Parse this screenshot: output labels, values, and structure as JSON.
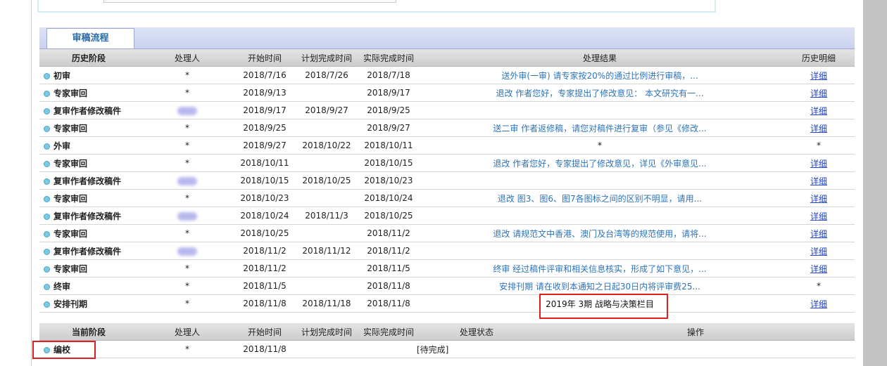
{
  "section": {
    "tab_label": "审稿流程"
  },
  "history": {
    "headers": [
      "历史阶段",
      "处理人",
      "开始时间",
      "计划完成时间",
      "实际完成时间",
      "处理结果",
      "历史明细"
    ],
    "rows": [
      {
        "stage": "初审",
        "handler": "*",
        "start": "2018/7/16",
        "planned": "2018/7/26",
        "actual": "2018/7/18",
        "result": "送外审(一审) 请专家按20%的通过比例进行审稿，...",
        "detail": "详细"
      },
      {
        "stage": "专家审回",
        "handler": "*",
        "start": "2018/9/13",
        "planned": "",
        "actual": "2018/9/17",
        "result": "退改 作者您好，专家提出了修改意见： 本文研究有一...",
        "detail": "详细"
      },
      {
        "stage": "复审作者修改稿件",
        "handler": "",
        "start": "2018/9/17",
        "planned": "2018/9/27",
        "actual": "2018/9/25",
        "result": "",
        "detail": "详细"
      },
      {
        "stage": "专家审回",
        "handler": "*",
        "start": "2018/9/25",
        "planned": "",
        "actual": "2018/9/27",
        "result": "送二审 作者返修稿，请您对稿件进行复审（参见《修改...",
        "detail": "详细"
      },
      {
        "stage": "外审",
        "handler": "*",
        "start": "2018/9/27",
        "planned": "2018/10/22",
        "actual": "2018/10/11",
        "result": "*",
        "detail": "*"
      },
      {
        "stage": "专家审回",
        "handler": "*",
        "start": "2018/10/11",
        "planned": "",
        "actual": "2018/10/15",
        "result": "退改 作者您好，专家提出了修改意见，详见《外审意见...",
        "detail": "详细"
      },
      {
        "stage": "复审作者修改稿件",
        "handler": "",
        "start": "2018/10/15",
        "planned": "2018/10/25",
        "actual": "2018/10/23",
        "result": "",
        "detail": "详细"
      },
      {
        "stage": "专家审回",
        "handler": "*",
        "start": "2018/10/23",
        "planned": "",
        "actual": "2018/10/24",
        "result": "退改 图3、图6、图7各图标之间的区别不明显，请用...",
        "detail": "详细"
      },
      {
        "stage": "复审作者修改稿件",
        "handler": "",
        "start": "2018/10/24",
        "planned": "2018/11/3",
        "actual": "2018/10/25",
        "result": "",
        "detail": "详细"
      },
      {
        "stage": "专家审回",
        "handler": "*",
        "start": "2018/10/25",
        "planned": "",
        "actual": "2018/11/2",
        "result": "退改 请规范文中香港、澳门及台湾等的规范使用，请将...",
        "detail": "详细"
      },
      {
        "stage": "复审作者修改稿件",
        "handler": "",
        "start": "2018/11/2",
        "planned": "2018/11/12",
        "actual": "2018/11/2",
        "result": "",
        "detail": "详细"
      },
      {
        "stage": "专家审回",
        "handler": "*",
        "start": "2018/11/2",
        "planned": "",
        "actual": "2018/11/5",
        "result": "终审 经过稿件评审和相关信息核实，形成了如下意见，...",
        "detail": "详细"
      },
      {
        "stage": "终审",
        "handler": "*",
        "start": "2018/11/5",
        "planned": "",
        "actual": "2018/11/8",
        "result": "安排刊期 请在收到本通知之日起30日内将评审费25...",
        "detail": "*"
      },
      {
        "stage": "安排刊期",
        "handler": "*",
        "start": "2018/11/8",
        "planned": "2018/11/18",
        "actual": "2018/11/8",
        "result": "2019年 3期 战略与决策栏目",
        "detail": "详细"
      }
    ]
  },
  "current": {
    "headers": [
      "当前阶段",
      "处理人",
      "开始时间",
      "计划完成时间",
      "实际完成时间",
      "处理状态",
      "操作"
    ],
    "rows": [
      {
        "stage": "编校",
        "handler": "*",
        "start": "2018/11/8",
        "planned": "",
        "actual": "",
        "status": "[待完成]",
        "action": ""
      }
    ]
  },
  "colors": {
    "accent": "#2e73b8",
    "link": "#2244cc",
    "highlight": "#e02020"
  }
}
